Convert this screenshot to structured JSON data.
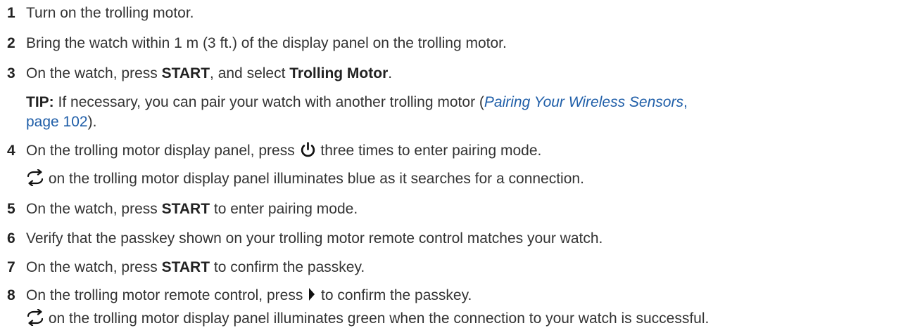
{
  "steps": [
    {
      "num": "1",
      "text": "Turn on the trolling motor."
    },
    {
      "num": "2",
      "text": "Bring the watch within 1 m (3 ft.) of the display panel on the trolling motor."
    },
    {
      "num": "3",
      "pre": "On the watch, press ",
      "key": "START",
      "mid": ", and select ",
      "item": "Trolling Motor",
      "post": "."
    },
    {
      "num": "4",
      "pre": "On the trolling motor display panel, press ",
      "post": " three times to enter pairing mode.",
      "icon": "power-icon"
    },
    {
      "num": "5",
      "pre": "On the watch, press ",
      "key": "START",
      "post": " to enter pairing mode."
    },
    {
      "num": "6",
      "text": "Verify that the passkey shown on your trolling motor remote control matches your watch."
    },
    {
      "num": "7",
      "pre": "On the watch, press ",
      "key": "START",
      "post": " to confirm the passkey."
    },
    {
      "num": "8",
      "pre": "On the trolling motor remote control, press ",
      "post": " to confirm the passkey.",
      "icon": "right-arrow-icon"
    }
  ],
  "tip": {
    "label": "TIP:",
    "text": " If necessary, you can pair your watch with another trolling motor (",
    "link_title": "Pairing Your Wireless Sensors",
    "link_sep": ",",
    "link_page": "page 102",
    "close": ")."
  },
  "notes": {
    "searching": " on the trolling motor display panel illuminates blue as it searches for a connection.",
    "success": " on the trolling motor display panel illuminates green when the connection to your watch is successful.",
    "icon": "sync-icon"
  }
}
